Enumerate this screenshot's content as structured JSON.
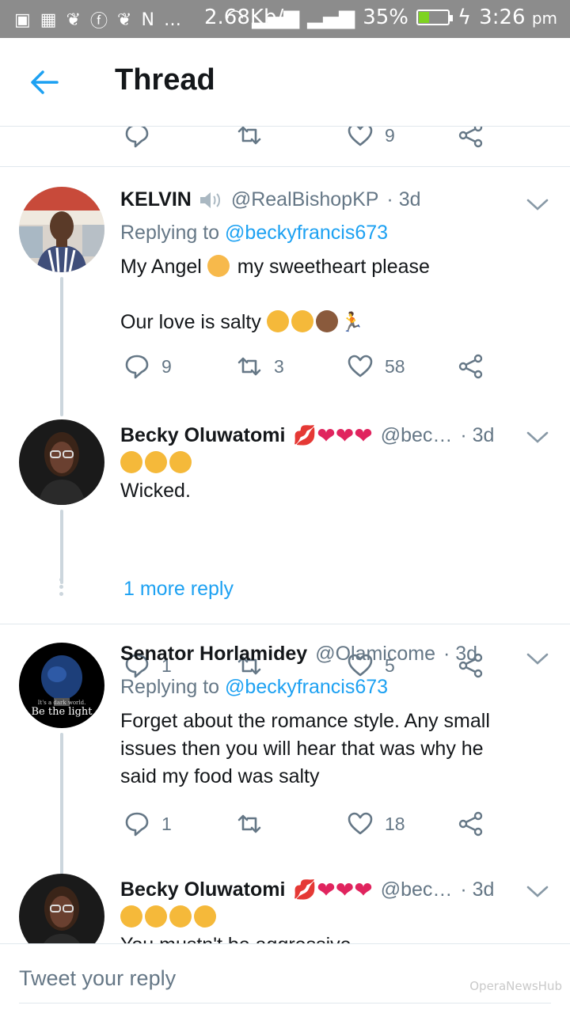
{
  "status_bar": {
    "speed": "2.68Kb/s",
    "battery": "35%",
    "battery_level": 0.35,
    "time": "3:26",
    "ampm": "pm"
  },
  "header": {
    "title": "Thread"
  },
  "top_actions": {
    "like_count": "9"
  },
  "tweets": [
    {
      "name": "KELVIN",
      "handle": "@RealBishopKP",
      "time": "· 3d",
      "replying_prefix": "Replying to",
      "replying_to": "@beckyfrancis673",
      "line1": "My Angel",
      "line1b": "my sweetheart please",
      "line2": "Our love is salty",
      "replies": "9",
      "retweets": "3",
      "likes": "58"
    },
    {
      "name": "Becky Oluwatomi",
      "handle": "@bec…",
      "time": "· 3d",
      "text": "Wicked.",
      "replies": "1",
      "retweets": "",
      "likes": "5"
    },
    {
      "name": "Senator Horlamidey",
      "handle": "@Olamicome",
      "time": "· 3d",
      "replying_prefix": "Replying to",
      "replying_to": "@beckyfrancis673",
      "text": "Forget about the romance style. Any small issues then you will hear that was why he said my food was salty",
      "avatar_text1": "It's a dark world.",
      "avatar_text2": "Be the light",
      "replies": "1",
      "retweets": "",
      "likes": "18"
    },
    {
      "name": "Becky Oluwatomi",
      "handle": "@bec…",
      "time": "· 3d",
      "text": "You mustn't be aggressive"
    }
  ],
  "more_reply": "1 more reply",
  "reply_bar": {
    "placeholder": "Tweet your reply",
    "watermark": "OperaNewsHub"
  },
  "colors": {
    "accent": "#1da1f2",
    "secondary": "#657786",
    "divider": "#e1e8ed",
    "threadline": "#ccd6dd"
  }
}
